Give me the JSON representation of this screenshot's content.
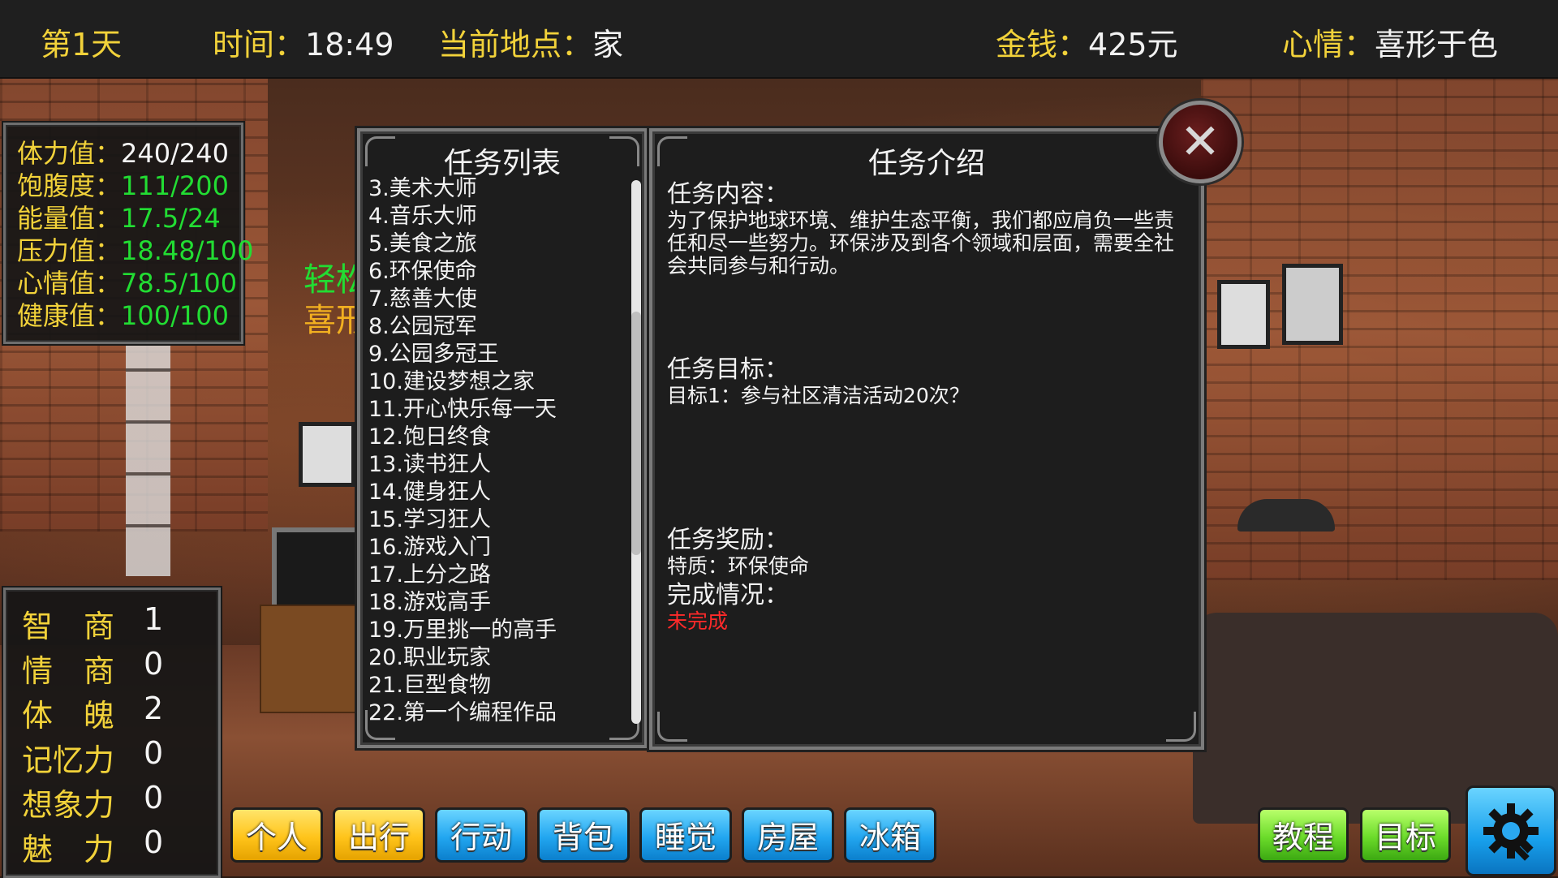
{
  "topbar": {
    "day": "第1天",
    "time_label": "时间：",
    "time_value": "18:49",
    "location_label": "当前地点：",
    "location_value": "家",
    "money_label": "金钱：",
    "money_value": "425元",
    "mood_label": "心情：",
    "mood_value": "喜形于色"
  },
  "stats": [
    {
      "label": "体力值：",
      "value": "240/240",
      "white": true
    },
    {
      "label": "饱腹度：",
      "value": "111/200",
      "white": false
    },
    {
      "label": "能量值：",
      "value": "17.5/24",
      "white": false
    },
    {
      "label": "压力值：",
      "value": "18.48/100",
      "white": false
    },
    {
      "label": "心情值：",
      "value": "78.5/100",
      "white": false
    },
    {
      "label": "健康值：",
      "value": "100/100",
      "white": false
    }
  ],
  "attributes": [
    {
      "label": "智　商",
      "value": "1"
    },
    {
      "label": "情　商",
      "value": "0"
    },
    {
      "label": "体　魄",
      "value": "2"
    },
    {
      "label": "记忆力",
      "value": "0"
    },
    {
      "label": "想象力",
      "value": "0"
    },
    {
      "label": "魅　力",
      "value": "0"
    }
  ],
  "side_text": {
    "line1": "轻松",
    "line2": "喜形"
  },
  "task_list": {
    "title": "任务列表",
    "items": [
      "3.美术大师",
      "4.音乐大师",
      "5.美食之旅",
      "6.环保使命",
      "7.慈善大使",
      "8.公园冠军",
      "9.公园多冠王",
      "10.建设梦想之家",
      "11.开心快乐每一天",
      "12.饱日终食",
      "13.读书狂人",
      "14.健身狂人",
      "15.学习狂人",
      "16.游戏入门",
      "17.上分之路",
      "18.游戏高手",
      "19.万里挑一的高手",
      "20.职业玩家",
      "21.巨型食物",
      "22.第一个编程作品"
    ]
  },
  "task_detail": {
    "title": "任务介绍",
    "content_label": "任务内容：",
    "content_text": "为了保护地球环境、维护生态平衡，我们都应肩负一些责任和尽一些努力。环保涉及到各个领域和层面，需要全社会共同参与和行动。",
    "goal_label": "任务目标：",
    "goal_text": "目标1：参与社区清洁活动20次？",
    "reward_label": "任务奖励：",
    "reward_text": "特质：环保使命",
    "status_label": "完成情况：",
    "status_text": "未完成"
  },
  "bottom_buttons": {
    "personal": "个人",
    "travel": "出行",
    "action": "行动",
    "backpack": "背包",
    "sleep": "睡觉",
    "house": "房屋",
    "fridge": "冰箱",
    "tutorial": "教程",
    "goal": "目标"
  },
  "icons": {
    "close": "close-icon",
    "settings": "gear-wrench-icon"
  },
  "colors": {
    "label_yellow": "#f2d23a",
    "value_green": "#22dd33",
    "incomplete_red": "#ff2a2a"
  }
}
